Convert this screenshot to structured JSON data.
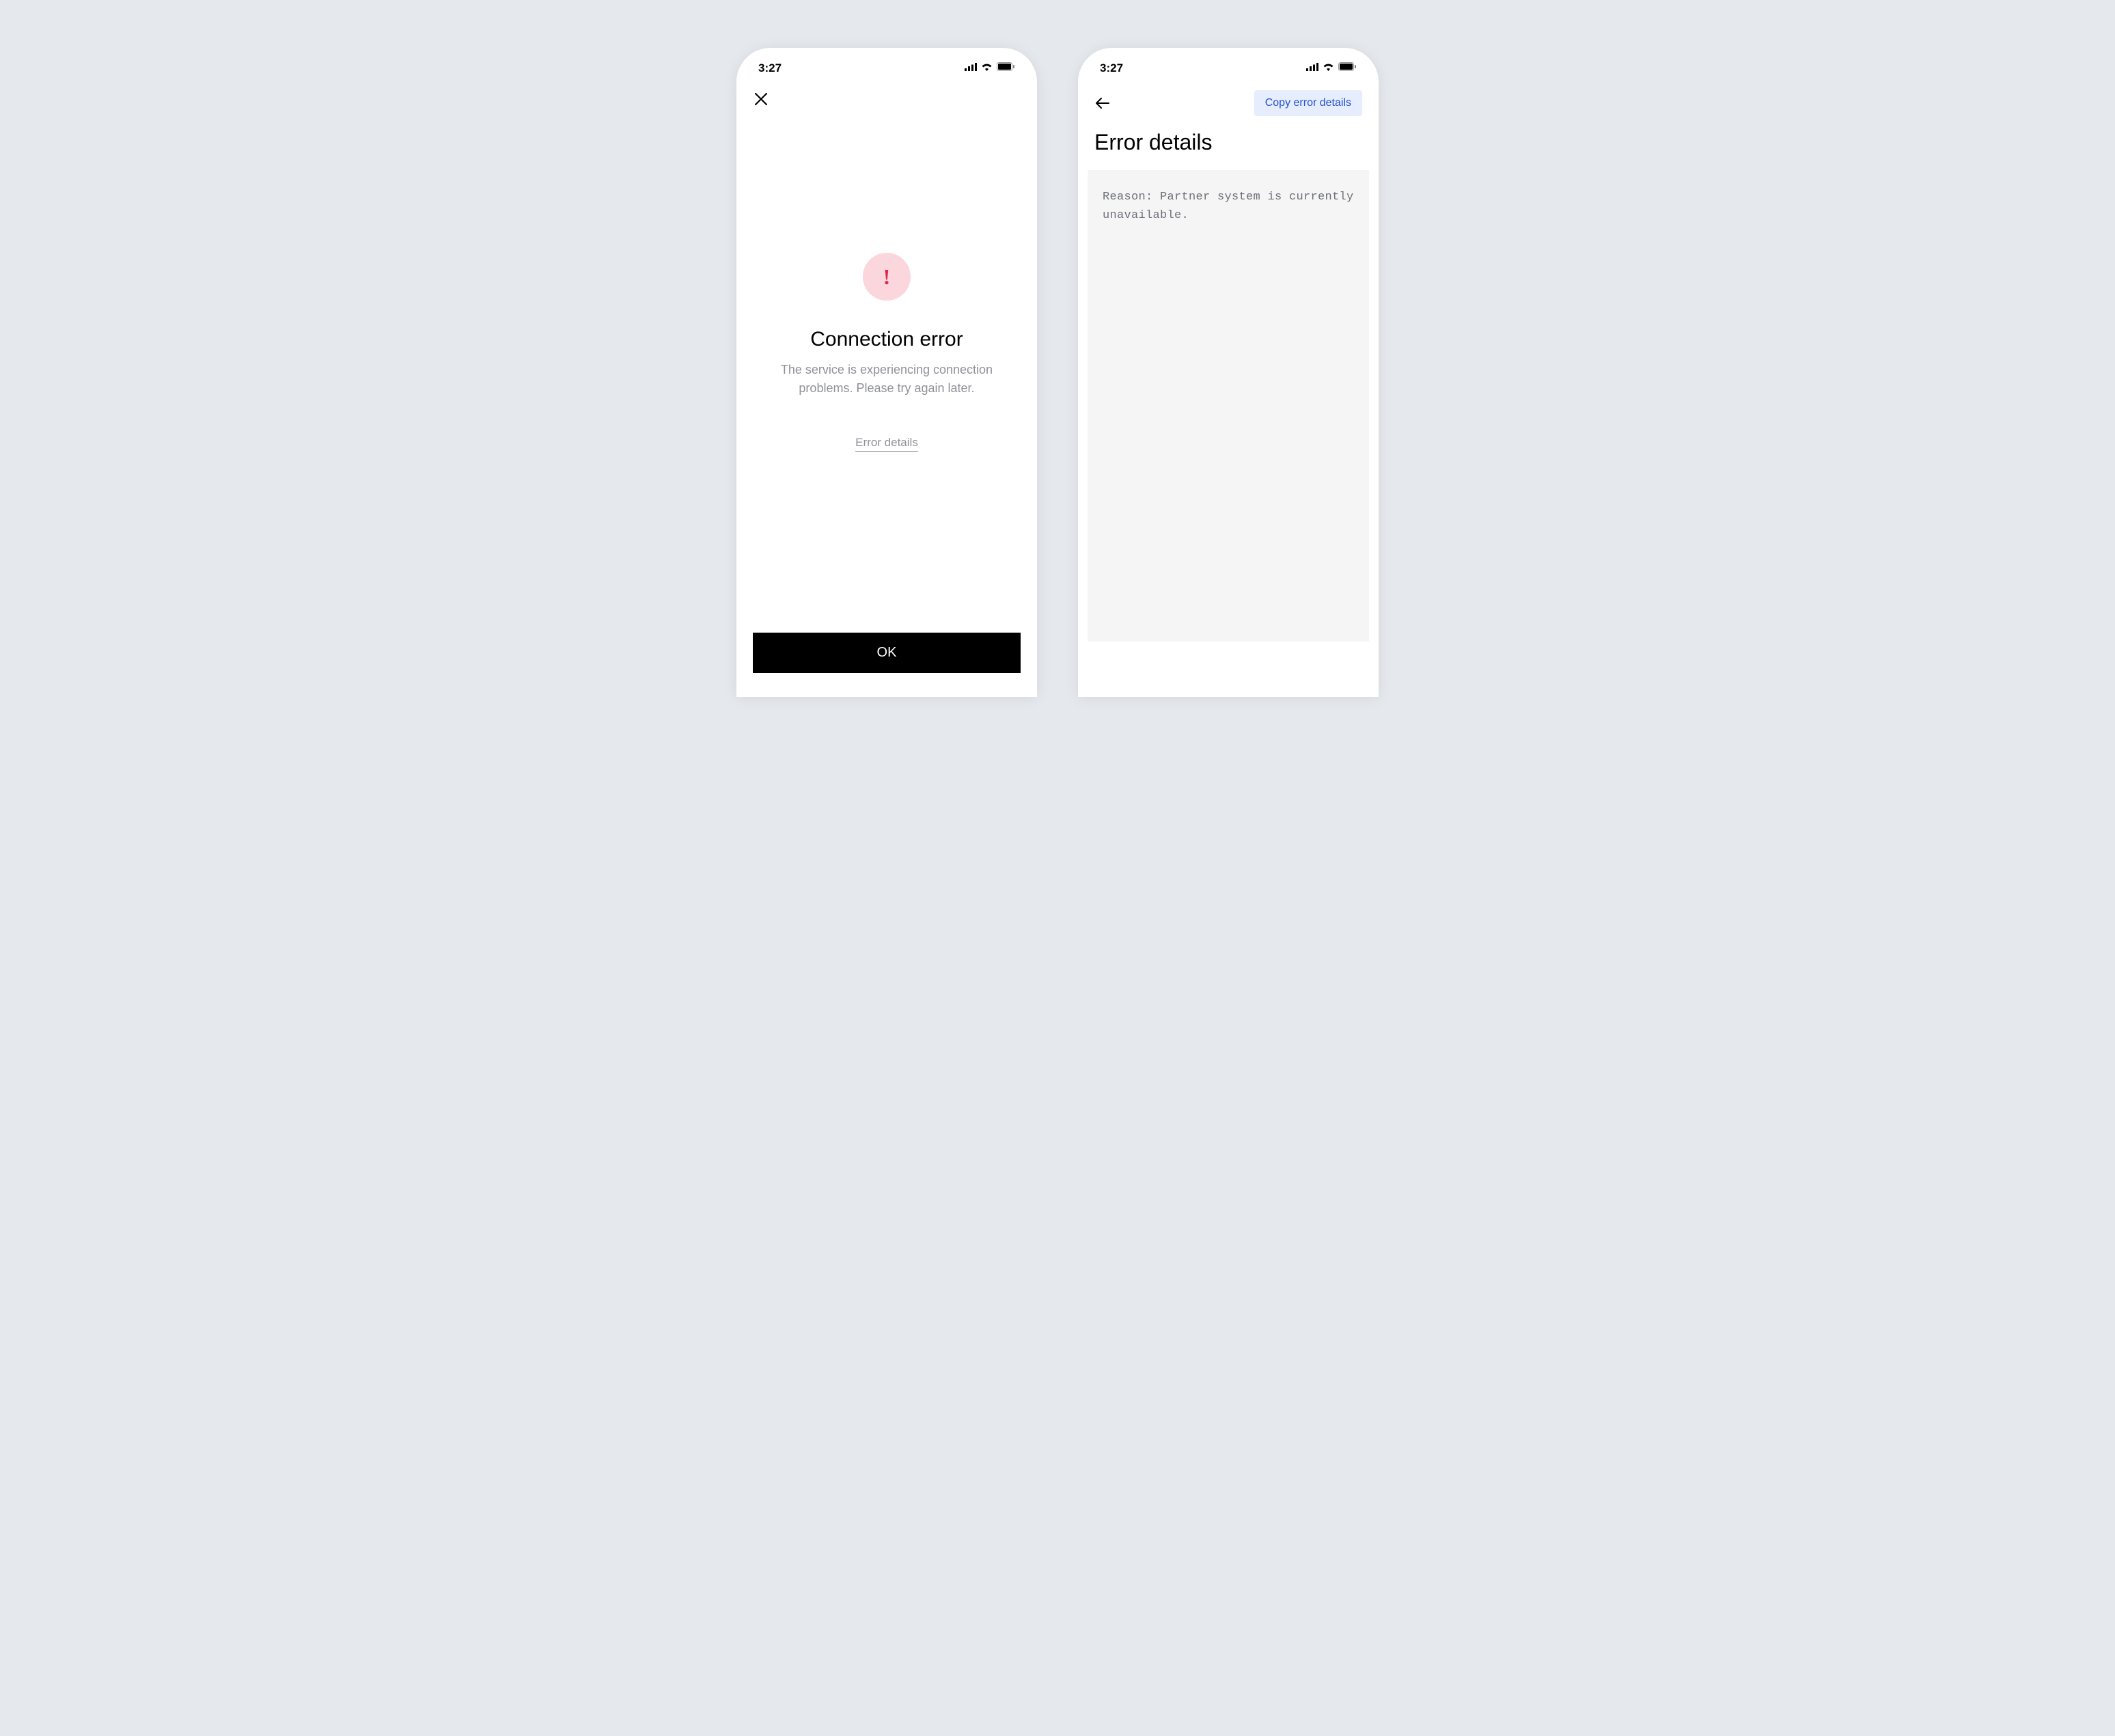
{
  "screen1": {
    "statusBar": {
      "time": "3:27"
    },
    "errorTitle": "Connection error",
    "errorSubtitle": "The service is experiencing connection problems. Please try again later.",
    "errorDetailsLink": "Error details",
    "okButton": "OK"
  },
  "screen2": {
    "statusBar": {
      "time": "3:27"
    },
    "copyButton": "Copy error details",
    "pageTitle": "Error details",
    "errorReason": "Reason: Partner system is currently unavailable."
  }
}
